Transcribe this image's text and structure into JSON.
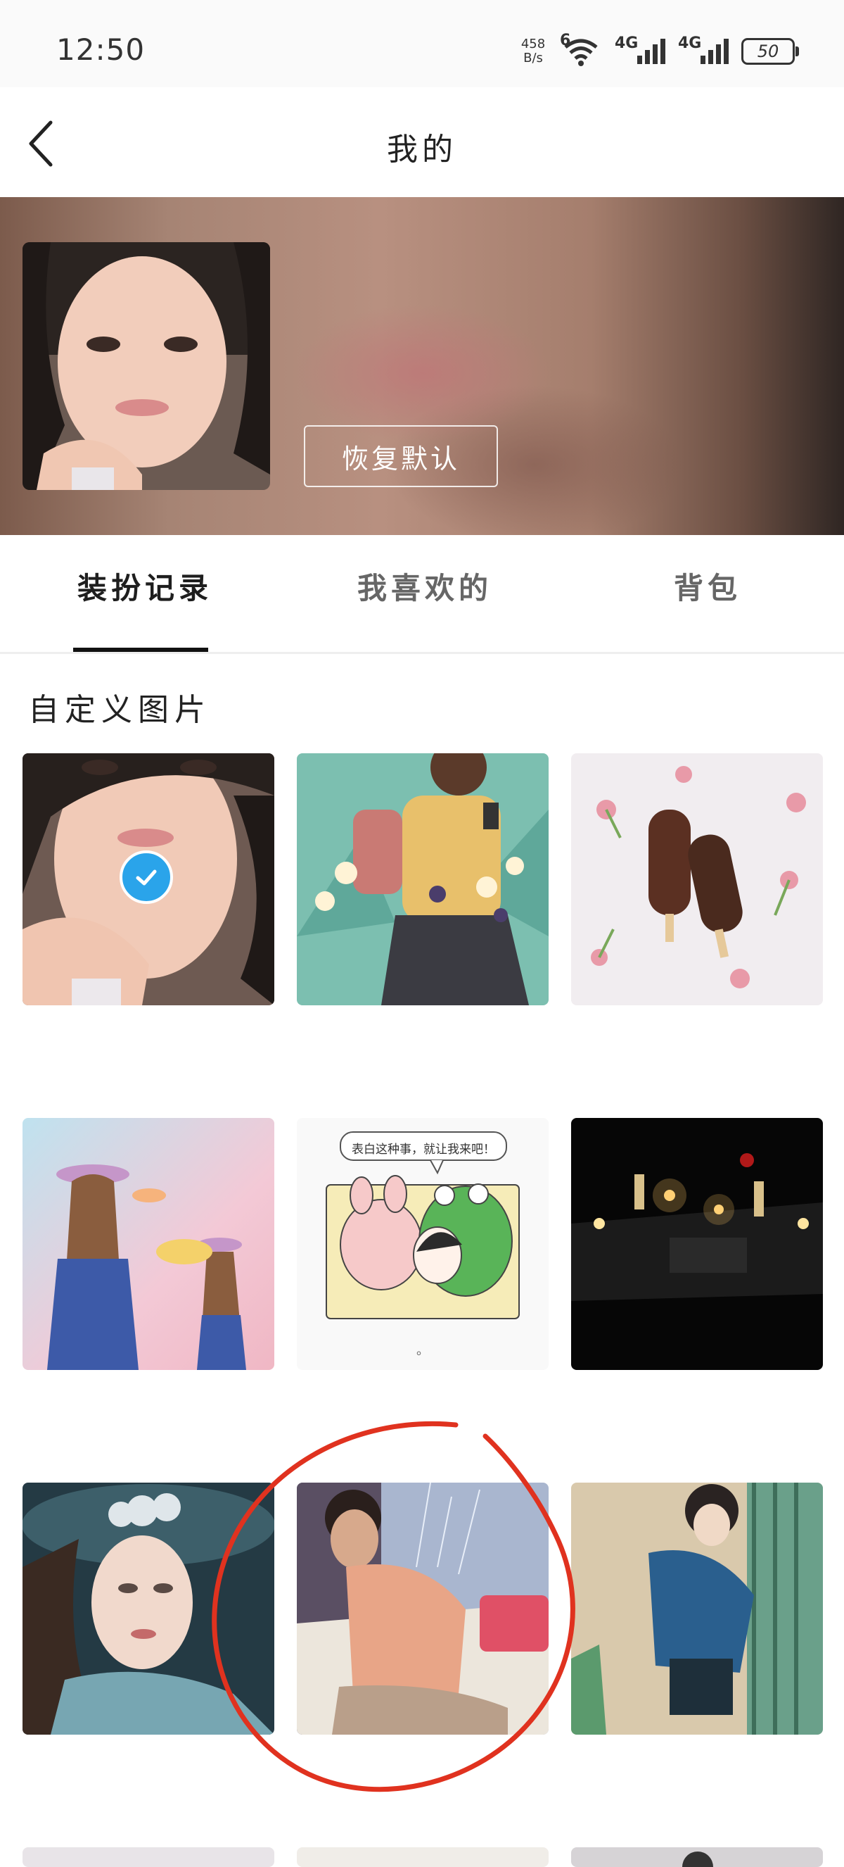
{
  "status_bar": {
    "time": "12:50",
    "net_speed_value": "458",
    "net_speed_unit": "B/s",
    "wifi_tag": "6",
    "sim1_tag": "4G",
    "sim2_tag": "4G",
    "battery": "50"
  },
  "nav": {
    "title": "我的",
    "back_icon": "chevron-left-icon"
  },
  "banner": {
    "restore_label": "恢复默认"
  },
  "tabs": [
    {
      "label": "装扮记录",
      "active": true
    },
    {
      "label": "我喜欢的",
      "active": false
    },
    {
      "label": "背包",
      "active": false
    }
  ],
  "section": {
    "title": "自定义图片"
  },
  "grid": {
    "selected_index": 0,
    "comic_bubble": "表白这种事，就让我来吧！",
    "comic_caption": "。"
  },
  "colors": {
    "accent": "#2aa4ea",
    "annotation": "#e0321f"
  }
}
